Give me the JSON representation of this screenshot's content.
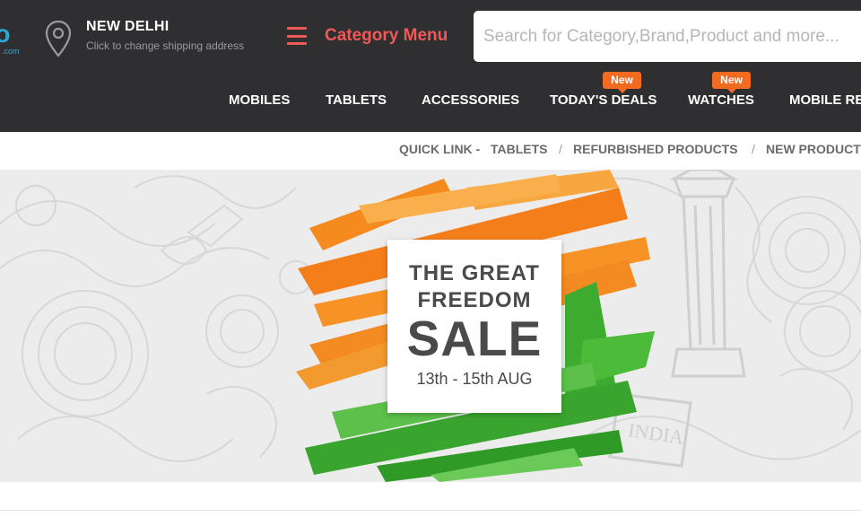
{
  "header": {
    "logo_text": "to",
    "logo_sub": ".com",
    "location": {
      "city": "NEW DELHI",
      "hint": "Click to change shipping address"
    },
    "category_menu": "Category Menu",
    "search_placeholder": "Search for Category,Brand,Product and more...",
    "nav": [
      {
        "label": "MOBILES"
      },
      {
        "label": "TABLETS"
      },
      {
        "label": "ACCESSORIES"
      },
      {
        "label": "TODAY'S DEALS",
        "badge": "New"
      },
      {
        "label": "WATCHES",
        "badge": "New"
      },
      {
        "label": "MOBILE RE"
      }
    ]
  },
  "quick_links": {
    "prefix": "QUICK LINK -",
    "items": [
      "TABLETS",
      "REFURBISHED PRODUCTS",
      "NEW PRODUCT"
    ],
    "separator": "/"
  },
  "banner": {
    "line1": "THE GREAT",
    "line2": "FREEDOM",
    "line3": "SALE",
    "dates": "13th - 15th AUG",
    "background_text": "INDIA"
  },
  "colors": {
    "header_bg": "#2f2e31",
    "accent": "#f05a56",
    "badge": "#f26b21",
    "saffron": "#f58a1f",
    "green": "#3cab2f"
  },
  "icons": {
    "location": "location-pin-icon",
    "menu": "hamburger-menu-icon"
  }
}
